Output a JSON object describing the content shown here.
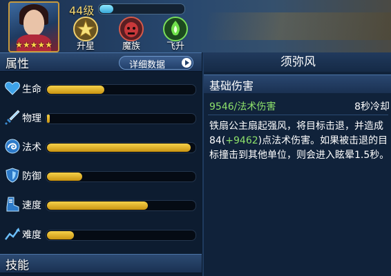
{
  "hero": {
    "stars": "★★★★★",
    "level": "44级",
    "exp_progress": 0.16
  },
  "badges": [
    {
      "label": "升星",
      "icon": "star-upgrade-icon",
      "color": "#c9a83a"
    },
    {
      "label": "魔族",
      "icon": "demon-faction-icon",
      "color": "#b0303a"
    },
    {
      "label": "飞升",
      "icon": "ascend-flame-icon",
      "color": "#3da83a"
    }
  ],
  "attributes": {
    "title": "属性",
    "detail_button": "详细数据",
    "rows": [
      {
        "label": "生命",
        "icon": "heart-icon",
        "value": 0.39
      },
      {
        "label": "物理",
        "icon": "sword-icon",
        "value": 0.01
      },
      {
        "label": "法术",
        "icon": "magic-swirl-icon",
        "value": 0.97
      },
      {
        "label": "防御",
        "icon": "shield-icon",
        "value": 0.24
      },
      {
        "label": "速度",
        "icon": "boot-icon",
        "value": 0.68
      },
      {
        "label": "难度",
        "icon": "difficulty-chart-icon",
        "value": 0.18
      }
    ]
  },
  "skills_section": {
    "title": "技能"
  },
  "skill": {
    "name": "须弥风",
    "section_title": "基础伤害",
    "damage": "9546/法术伤害",
    "cooldown": "8秒冷却",
    "desc_part1": "铁扇公主扇起强风，将目标击退，并造成84(",
    "desc_highlight": "+9462",
    "desc_part2": ")点法术伤害。如果被击退的目标撞击到其他单位，则会进入眩晕1.5秒。"
  }
}
